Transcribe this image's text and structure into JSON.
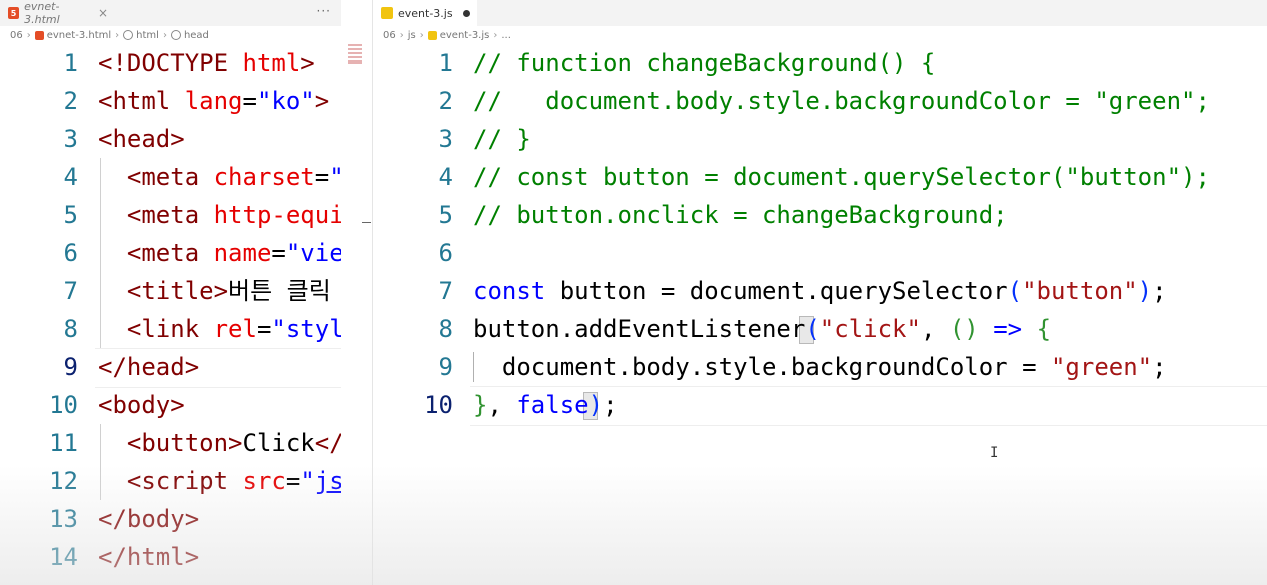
{
  "left_editor": {
    "tab": {
      "label": "evnet-3.html",
      "icon": "html5-icon",
      "close": "×"
    },
    "tab_more": "···",
    "breadcrumb": [
      {
        "label": "06",
        "icon": ""
      },
      {
        "label": "evnet-3.html",
        "icon": "html5-icon"
      },
      {
        "label": "html",
        "icon": "tag-icon"
      },
      {
        "label": "head",
        "icon": "tag-icon"
      }
    ],
    "lines": [
      {
        "n": "1",
        "tokens": [
          {
            "t": "<!DOCTYPE ",
            "c": "t-tag"
          },
          {
            "t": "html",
            "c": "t-attr"
          },
          {
            "t": ">",
            "c": "t-tag"
          }
        ]
      },
      {
        "n": "2",
        "tokens": [
          {
            "t": "<html ",
            "c": "t-tag"
          },
          {
            "t": "lang",
            "c": "t-attr"
          },
          {
            "t": "=",
            "c": "t-plain"
          },
          {
            "t": "\"ko\"",
            "c": "t-str"
          },
          {
            "t": ">",
            "c": "t-tag"
          }
        ]
      },
      {
        "n": "3",
        "tokens": [
          {
            "t": "<head>",
            "c": "t-tag"
          }
        ]
      },
      {
        "n": "4",
        "tokens": [
          {
            "t": "  <meta ",
            "c": "t-tag"
          },
          {
            "t": "charset",
            "c": "t-attr"
          },
          {
            "t": "=",
            "c": "t-plain"
          },
          {
            "t": "\"U",
            "c": "t-str"
          }
        ]
      },
      {
        "n": "5",
        "tokens": [
          {
            "t": "  <meta ",
            "c": "t-tag"
          },
          {
            "t": "http-equiv",
            "c": "t-attr"
          }
        ]
      },
      {
        "n": "6",
        "tokens": [
          {
            "t": "  <meta ",
            "c": "t-tag"
          },
          {
            "t": "name",
            "c": "t-attr"
          },
          {
            "t": "=",
            "c": "t-plain"
          },
          {
            "t": "\"view",
            "c": "t-str"
          }
        ]
      },
      {
        "n": "7",
        "tokens": [
          {
            "t": "  <title>",
            "c": "t-tag"
          },
          {
            "t": "버튼 클릭",
            "c": "t-plain"
          }
        ]
      },
      {
        "n": "8",
        "tokens": [
          {
            "t": "  <link ",
            "c": "t-tag"
          },
          {
            "t": "rel",
            "c": "t-attr"
          },
          {
            "t": "=",
            "c": "t-plain"
          },
          {
            "t": "\"style",
            "c": "t-str"
          }
        ]
      },
      {
        "n": "9",
        "tokens": [
          {
            "t": "</head>",
            "c": "t-tag"
          }
        ]
      },
      {
        "n": "10",
        "tokens": [
          {
            "t": "<body>",
            "c": "t-tag"
          }
        ]
      },
      {
        "n": "11",
        "tokens": [
          {
            "t": "  <button>",
            "c": "t-tag"
          },
          {
            "t": "Click",
            "c": "t-plain"
          },
          {
            "t": "</b",
            "c": "t-tag"
          }
        ]
      },
      {
        "n": "12",
        "tokens": [
          {
            "t": "  <script ",
            "c": "t-tag"
          },
          {
            "t": "src",
            "c": "t-attr"
          },
          {
            "t": "=",
            "c": "t-plain"
          },
          {
            "t": "\"",
            "c": "t-str"
          },
          {
            "t": "js/",
            "c": "t-link"
          }
        ]
      },
      {
        "n": "13",
        "tokens": [
          {
            "t": "</body>",
            "c": "t-tag"
          }
        ]
      },
      {
        "n": "14",
        "tokens": [
          {
            "t": "</html>",
            "c": "t-tag"
          }
        ]
      }
    ]
  },
  "right_editor": {
    "tab": {
      "label": "event-3.js",
      "icon": "js-file-icon"
    },
    "breadcrumb": [
      {
        "label": "06",
        "icon": ""
      },
      {
        "label": "js",
        "icon": ""
      },
      {
        "label": "event-3.js",
        "icon": "js-file-icon"
      },
      {
        "label": "...",
        "icon": ""
      }
    ],
    "lines": [
      {
        "n": "1",
        "tokens": [
          {
            "t": "// function changeBackground() {",
            "c": "t-comment"
          }
        ]
      },
      {
        "n": "2",
        "tokens": [
          {
            "t": "//   document.body.style.backgroundColor = \"green\";",
            "c": "t-comment"
          }
        ]
      },
      {
        "n": "3",
        "tokens": [
          {
            "t": "// }",
            "c": "t-comment"
          }
        ]
      },
      {
        "n": "4",
        "tokens": [
          {
            "t": "// const button = document.querySelector(\"button\");",
            "c": "t-comment"
          }
        ]
      },
      {
        "n": "5",
        "tokens": [
          {
            "t": "// button.onclick = changeBackground;",
            "c": "t-comment"
          }
        ]
      },
      {
        "n": "6",
        "tokens": []
      },
      {
        "n": "7",
        "tokens": [
          {
            "t": "const",
            "c": "t-kw"
          },
          {
            "t": " button = document.querySelector",
            "c": "t-plain"
          },
          {
            "t": "(",
            "c": "t-br1"
          },
          {
            "t": "\"button\"",
            "c": "t-jsstr"
          },
          {
            "t": ")",
            "c": "t-br1"
          },
          {
            "t": ";",
            "c": "t-plain"
          }
        ]
      },
      {
        "n": "8",
        "tokens": [
          {
            "t": "button.addEventListener",
            "c": "t-plain"
          },
          {
            "t": "(",
            "c": "t-br1"
          },
          {
            "t": "\"click\"",
            "c": "t-jsstr"
          },
          {
            "t": ", ",
            "c": "t-plain"
          },
          {
            "t": "()",
            "c": "t-br2"
          },
          {
            "t": " ",
            "c": "t-plain"
          },
          {
            "t": "=>",
            "c": "t-kw"
          },
          {
            "t": " ",
            "c": "t-plain"
          },
          {
            "t": "{",
            "c": "t-br2"
          }
        ]
      },
      {
        "n": "9",
        "tokens": [
          {
            "t": "  document.body.style.backgroundColor = ",
            "c": "t-plain"
          },
          {
            "t": "\"green\"",
            "c": "t-jsstr"
          },
          {
            "t": ";",
            "c": "t-plain"
          }
        ]
      },
      {
        "n": "10",
        "tokens": [
          {
            "t": "}",
            "c": "t-br2"
          },
          {
            "t": ", ",
            "c": "t-plain"
          },
          {
            "t": "false",
            "c": "t-kw"
          },
          {
            "t": ")",
            "c": "t-br1"
          },
          {
            "t": ";",
            "c": "t-plain"
          }
        ]
      }
    ]
  },
  "colors": {
    "line_number": "#237893",
    "active_line_number": "#0b216f",
    "html_tag": "#800000",
    "html_attr": "#e50000",
    "html_string": "#0000ff",
    "comment": "#008000",
    "keyword": "#0000ff",
    "js_string": "#a31515"
  }
}
